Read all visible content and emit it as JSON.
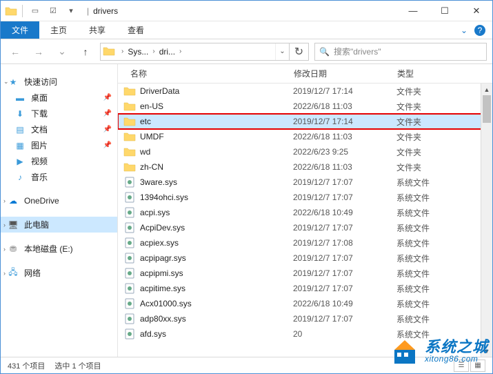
{
  "window": {
    "title": "drivers",
    "qat_checkbox": "☑",
    "min": "—",
    "max": "☐",
    "close": "✕"
  },
  "ribbon": {
    "file": "文件",
    "home": "主页",
    "share": "共享",
    "view": "查看",
    "expand": "⌄",
    "help": "?"
  },
  "nav": {
    "back": "←",
    "fwd": "→",
    "recent": "⌄",
    "up": "↑",
    "refresh": "↻",
    "dropdown": "⌄"
  },
  "breadcrumb": {
    "seg1": "Sys...",
    "seg2": "dri...",
    "chev": "›"
  },
  "search": {
    "icon": "🔍",
    "placeholder": "搜索\"drivers\""
  },
  "sidebar": {
    "quick": {
      "label": "快速访问",
      "caret": "⌄"
    },
    "desktop": {
      "label": "桌面",
      "pin": "📌"
    },
    "downloads": {
      "label": "下载",
      "pin": "📌"
    },
    "documents": {
      "label": "文档",
      "pin": "📌"
    },
    "pictures": {
      "label": "图片",
      "pin": "📌"
    },
    "videos": {
      "label": "视频"
    },
    "music": {
      "label": "音乐"
    },
    "onedrive": {
      "label": "OneDrive",
      "caret": "›"
    },
    "thispc": {
      "label": "此电脑",
      "caret": "›"
    },
    "localdisk": {
      "label": "本地磁盘 (E:)",
      "caret": "›"
    },
    "network": {
      "label": "网络",
      "caret": "›"
    }
  },
  "columns": {
    "name": "名称",
    "date": "修改日期",
    "type": "类型"
  },
  "typelabels": {
    "folder": "文件夹",
    "sysfile": "系统文件"
  },
  "files": [
    {
      "name": "DriverData",
      "date": "2019/12/7 17:14",
      "kind": "folder"
    },
    {
      "name": "en-US",
      "date": "2022/6/18 11:03",
      "kind": "folder"
    },
    {
      "name": "etc",
      "date": "2019/12/7 17:14",
      "kind": "folder",
      "selected": true,
      "highlighted": true
    },
    {
      "name": "UMDF",
      "date": "2022/6/18 11:03",
      "kind": "folder"
    },
    {
      "name": "wd",
      "date": "2022/6/23 9:25",
      "kind": "folder"
    },
    {
      "name": "zh-CN",
      "date": "2022/6/18 11:03",
      "kind": "folder"
    },
    {
      "name": "3ware.sys",
      "date": "2019/12/7 17:07",
      "kind": "sysfile"
    },
    {
      "name": "1394ohci.sys",
      "date": "2019/12/7 17:07",
      "kind": "sysfile"
    },
    {
      "name": "acpi.sys",
      "date": "2022/6/18 10:49",
      "kind": "sysfile"
    },
    {
      "name": "AcpiDev.sys",
      "date": "2019/12/7 17:07",
      "kind": "sysfile"
    },
    {
      "name": "acpiex.sys",
      "date": "2019/12/7 17:08",
      "kind": "sysfile"
    },
    {
      "name": "acpipagr.sys",
      "date": "2019/12/7 17:07",
      "kind": "sysfile"
    },
    {
      "name": "acpipmi.sys",
      "date": "2019/12/7 17:07",
      "kind": "sysfile"
    },
    {
      "name": "acpitime.sys",
      "date": "2019/12/7 17:07",
      "kind": "sysfile"
    },
    {
      "name": "Acx01000.sys",
      "date": "2022/6/18 10:49",
      "kind": "sysfile"
    },
    {
      "name": "adp80xx.sys",
      "date": "2019/12/7 17:07",
      "kind": "sysfile"
    },
    {
      "name": "afd.sys",
      "date": "20",
      "kind": "sysfile"
    }
  ],
  "status": {
    "items": "431 个项目",
    "selected": "选中 1 个项目"
  },
  "watermark": {
    "main": "系统之城",
    "sub": "xitong86.com"
  }
}
